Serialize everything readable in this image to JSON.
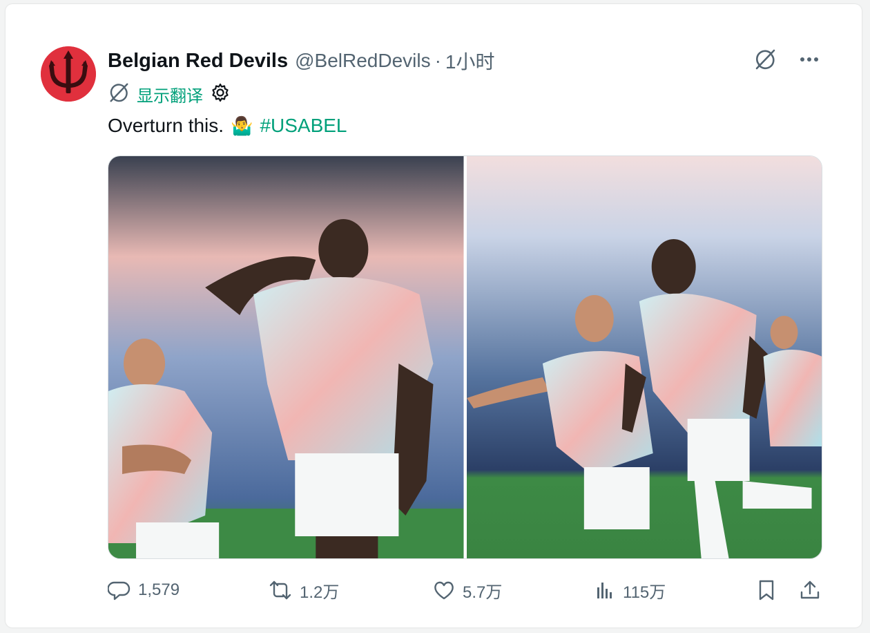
{
  "post": {
    "author_name": "Belgian Red Devils",
    "author_handle": "@BelRedDevils",
    "separator": "·",
    "time": "1小时",
    "translate_label": "显示翻译",
    "text": "Overturn this.",
    "emoji": "🤷‍♂️",
    "hashtag": "#USABEL",
    "photos": [
      {
        "alt": "Player number 9 celebrating with hand to ear, teammate 21 behind"
      },
      {
        "alt": "Player 9 and player 21 running in celebration"
      }
    ]
  },
  "actions": {
    "replies": "1,579",
    "reposts": "1.2万",
    "likes": "5.7万",
    "views": "115万"
  },
  "colors": {
    "accent": "#00a07a",
    "avatar_bg": "#e0303d",
    "muted": "#536471"
  },
  "icons": [
    "devil-trident-logo-icon",
    "grok-slash-icon",
    "more-icon",
    "translate-icon",
    "gear-icon",
    "reply-icon",
    "repost-icon",
    "like-icon",
    "views-icon",
    "bookmark-icon",
    "share-icon"
  ]
}
